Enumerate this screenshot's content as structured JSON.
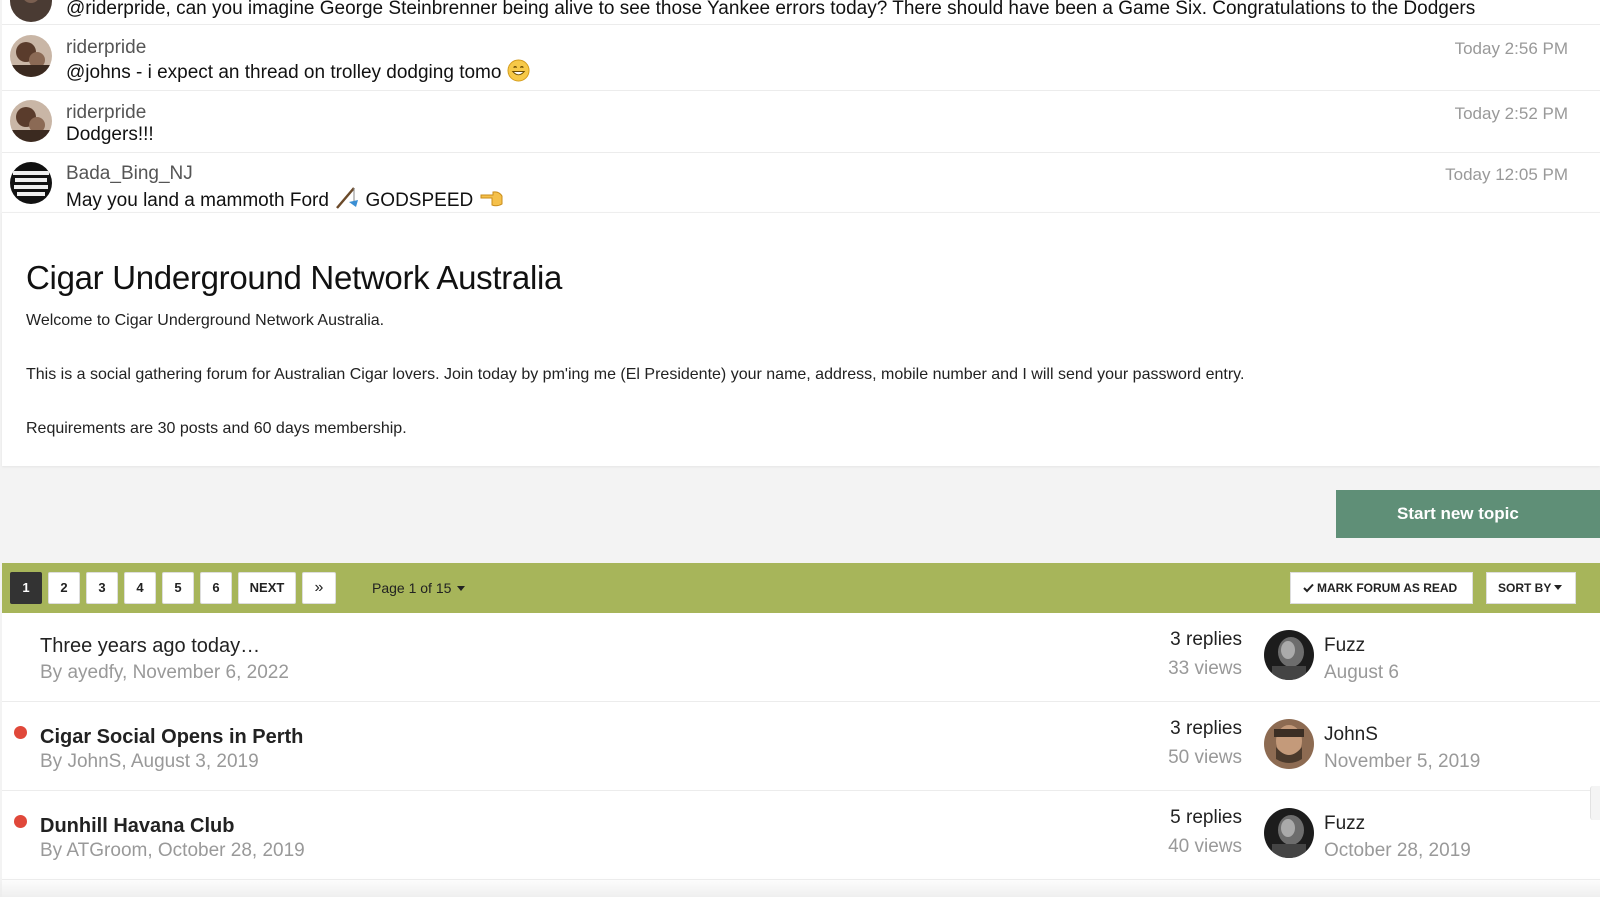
{
  "shoutbox": {
    "shouts": [
      {
        "username": "",
        "message": "@riderpride, can you imagine George Steinbrenner being alive to see those Yankee errors today? There should have been a Game Six. Congratulations to the Dodgers",
        "time": ""
      },
      {
        "username": "riderpride",
        "message": "@johns - i expect an thread on trolley dodging tomo",
        "time": "Today 2:56 PM",
        "emoji": "grinning-face"
      },
      {
        "username": "riderpride",
        "message": "Dodgers!!!",
        "time": "Today 2:52 PM"
      },
      {
        "username": "Bada_Bing_NJ",
        "message_part1": "May you land a mammoth Ford",
        "message_part2": "GODSPEED",
        "time": "Today 12:05 PM",
        "emoji1": "fishing-pole",
        "emoji2": "backhand-pointing-left"
      }
    ]
  },
  "forum": {
    "title": "Cigar Underground Network Australia",
    "paragraphs": [
      "Welcome to Cigar Underground Network Australia.",
      "This is a social gathering forum for Australian Cigar lovers. Join today by pm'ing me (El Presidente) your name, address, mobile number and I will send your password entry.",
      "Requirements are 30 posts and 60 days membership."
    ],
    "start_topic_label": "Start new topic"
  },
  "pagination": {
    "pages": [
      "1",
      "2",
      "3",
      "4",
      "5",
      "6"
    ],
    "active_page": "1",
    "next_label": "NEXT",
    "last_label": "»",
    "page_jump": "Page 1 of 15",
    "mark_read_label": "MARK FORUM AS READ",
    "sort_label": "SORT BY",
    "accent_color": "#a7b55a"
  },
  "topics": [
    {
      "title": "Three years ago today…",
      "meta": "By ayedfy, November 6, 2022",
      "replies": "3 replies",
      "views": "33 views",
      "last_user": "Fuzz",
      "last_date": "August 6",
      "unread": false
    },
    {
      "title": "Cigar Social Opens in Perth",
      "meta": "By JohnS, August 3, 2019",
      "replies": "3 replies",
      "views": "50 views",
      "last_user": "JohnS",
      "last_date": "November 5, 2019",
      "unread": true
    },
    {
      "title": "Dunhill Havana Club",
      "meta": "By ATGroom, October 28, 2019",
      "replies": "5 replies",
      "views": "40 views",
      "last_user": "Fuzz",
      "last_date": "October 28, 2019",
      "unread": true
    }
  ],
  "colors": {
    "start_topic": "#5f8f77",
    "unread_dot": "#e0483a",
    "active_page": "#333333"
  }
}
